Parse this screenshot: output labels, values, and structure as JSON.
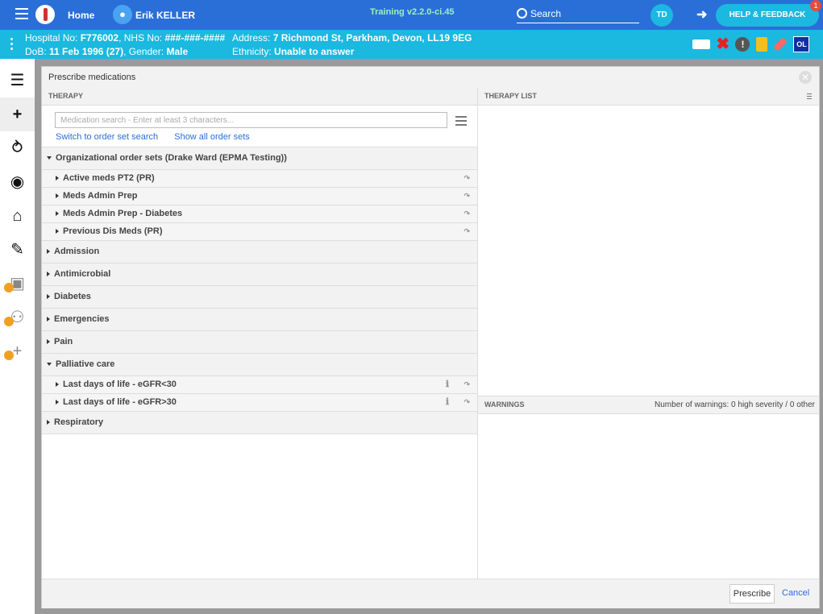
{
  "topbar": {
    "home_label": "Home",
    "patient_name": "Erik KELLER",
    "environment": "Training v2.2.0-ci.45",
    "search_label": "Search",
    "user_initials": "TD",
    "help_label": "HELP & FEEDBACK",
    "notification_count": "1"
  },
  "patient": {
    "hospital_label": "Hospital No:",
    "hospital_no": "F776002",
    "nhs_label": "NHS No:",
    "nhs_no": "###-###-####",
    "address_label": "Address:",
    "address": "7 Richmond St, Parkham, Devon, LL19 9EG",
    "dob_label": "DoB:",
    "dob": "11 Feb 1996 (27)",
    "gender_label": "Gender:",
    "gender": "Male",
    "ethnicity_label": "Ethnicity:",
    "ethnicity": "Unable to answer",
    "flag_ol": "OL"
  },
  "sidenav": {
    "icons": [
      "list-icon",
      "plus-icon",
      "stethoscope-icon",
      "camera-icon",
      "home-plus-icon",
      "sign-icon",
      "locked-note-icon",
      "locked-walk-icon",
      "locked-plus-icon"
    ]
  },
  "modal": {
    "title": "Prescribe medications",
    "therapy_header": "THERAPY",
    "therapy_list_header": "THERAPY LIST",
    "warnings_header": "WARNINGS",
    "warnings_count": "Number of warnings: 0 high severity / 0 other",
    "search_placeholder": "Medication search - Enter at least 3 characters...",
    "switch_link": "Switch to order set search",
    "show_all_link": "Show all order sets",
    "prescribe_label": "Prescribe",
    "cancel_label": "Cancel"
  },
  "order_sets": [
    {
      "label": "Organizational order sets (Drake Ward (EPMA Testing))",
      "expanded": true,
      "children": [
        {
          "label": "Active meds PT2 (PR)"
        },
        {
          "label": "Meds Admin Prep"
        },
        {
          "label": "Meds Admin Prep - Diabetes"
        },
        {
          "label": "Previous Dis Meds (PR)"
        }
      ]
    },
    {
      "label": "Admission",
      "expanded": false
    },
    {
      "label": "Antimicrobial",
      "expanded": false
    },
    {
      "label": "Diabetes",
      "expanded": false
    },
    {
      "label": "Emergencies",
      "expanded": false
    },
    {
      "label": "Pain",
      "expanded": false
    },
    {
      "label": "Palliative care",
      "expanded": true,
      "children": [
        {
          "label": "Last days of life - eGFR<30",
          "info": true
        },
        {
          "label": "Last days of life - eGFR>30",
          "info": true
        }
      ]
    },
    {
      "label": "Respiratory",
      "expanded": false
    }
  ]
}
